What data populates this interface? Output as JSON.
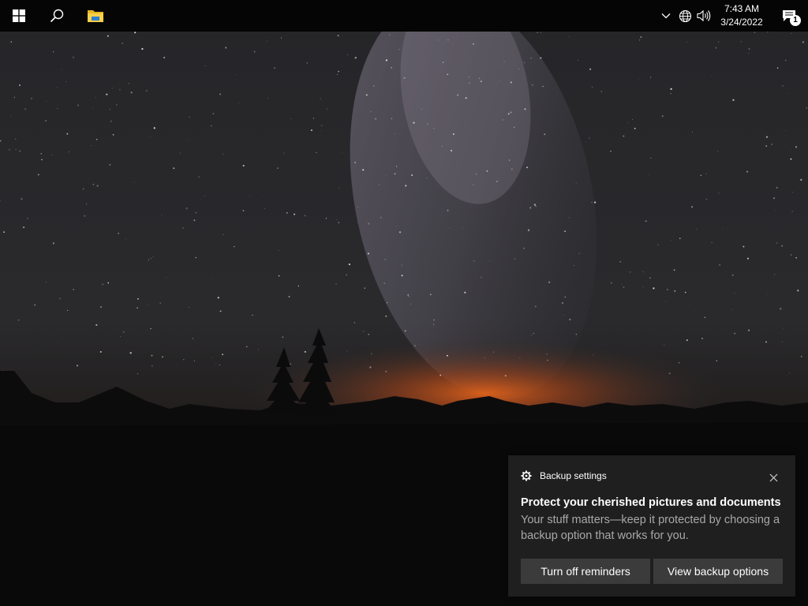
{
  "taskbar": {
    "start_icon": "windows-logo-icon",
    "search_icon": "search-icon",
    "explorer_icon": "file-explorer-icon",
    "tray": {
      "icons": [
        "chevron-up-icon",
        "network-globe-icon",
        "volume-icon"
      ],
      "time": "7:43 AM",
      "date": "3/24/2022",
      "notifications_icon": "action-center-icon",
      "notification_count": "1"
    }
  },
  "toast": {
    "app_icon": "gear-icon",
    "app_name": "Backup settings",
    "title": "Protect your cherished pictures and documents",
    "body": "Your stuff matters—keep it protected by choosing a backup option that works for you.",
    "close_icon": "close-icon",
    "buttons": [
      "Turn off reminders",
      "View backup options"
    ]
  },
  "colors": {
    "taskbar": "#050505",
    "toast_bg": "#1f1f1f",
    "toast_button": "#3b3b3b",
    "horizon_glow": "#e0621a"
  }
}
